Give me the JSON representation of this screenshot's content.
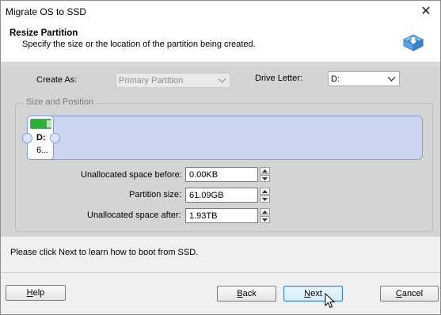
{
  "window": {
    "title": "Migrate OS to SSD"
  },
  "header": {
    "heading": "Resize Partition",
    "subheading": "Specify the size or the location of the partition being created."
  },
  "form": {
    "create_as_label": "Create As:",
    "create_as_value": "Primary Partition",
    "drive_letter_label": "Drive Letter:",
    "drive_letter_value": "D:"
  },
  "group": {
    "title": "Size and Position",
    "partition_letter": "D:",
    "partition_size_short": "6..."
  },
  "fields": {
    "unalloc_before_label": "Unallocated space before:",
    "unalloc_before_value": "0.00KB",
    "partition_size_label": "Partition size:",
    "partition_size_value": "61.09GB",
    "unalloc_after_label": "Unallocated space after:",
    "unalloc_after_value": "1.93TB"
  },
  "info_text": "Please click Next to learn how to boot from SSD.",
  "buttons": {
    "help": {
      "first": "H",
      "rest": "elp"
    },
    "back": {
      "first": "B",
      "rest": "ack"
    },
    "next": {
      "first": "N",
      "rest": "ext"
    },
    "cancel": {
      "first": "C",
      "rest": "ancel"
    }
  },
  "icons": {
    "close": "close-icon",
    "logo": "disk-migrate-icon",
    "dropdown": "chevron-down-icon",
    "battery": "battery-icon",
    "cursor": "mouse-pointer-icon"
  },
  "colors": {
    "partition_fill": "#ccd6f1",
    "partition_border": "#7fa0d6",
    "battery_green": "#2bb036",
    "main_bg": "#d4d4d4"
  }
}
